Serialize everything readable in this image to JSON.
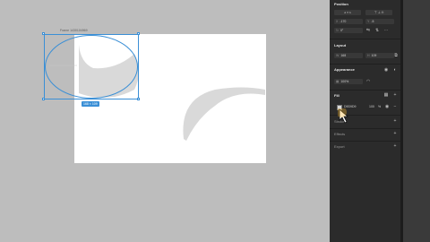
{
  "canvas": {
    "frame_label": "Frame 1430104969",
    "size_badge": "168 × 109",
    "colors": {
      "canvas_bg": "#bdbdbd",
      "frame_bg": "#ffffff",
      "selection": "#3a8fd6",
      "shape_fill": "#d9d9d9"
    }
  },
  "panel": {
    "position": {
      "title": "Position",
      "align_icons": [
        "align-left-icon",
        "align-center-h-icon",
        "align-right-icon",
        "align-top-icon",
        "align-middle-icon",
        "align-bottom-icon"
      ],
      "x_label": "X",
      "x_value": "-170",
      "y_label": "Y",
      "y_value": "-5",
      "rotation_value": "0°"
    },
    "layout": {
      "title": "Layout",
      "w_label": "W",
      "w_value": "168",
      "h_label": "H",
      "h_value": "109"
    },
    "appearance": {
      "title": "Appearance",
      "opacity_value": "100%"
    },
    "fill": {
      "title": "Fill",
      "hex_value": "D9D9D9",
      "opacity_value": "100",
      "unit": "%"
    },
    "stroke": {
      "title": "Stroke"
    },
    "effects": {
      "title": "Effects"
    },
    "export": {
      "title": "Export"
    }
  }
}
